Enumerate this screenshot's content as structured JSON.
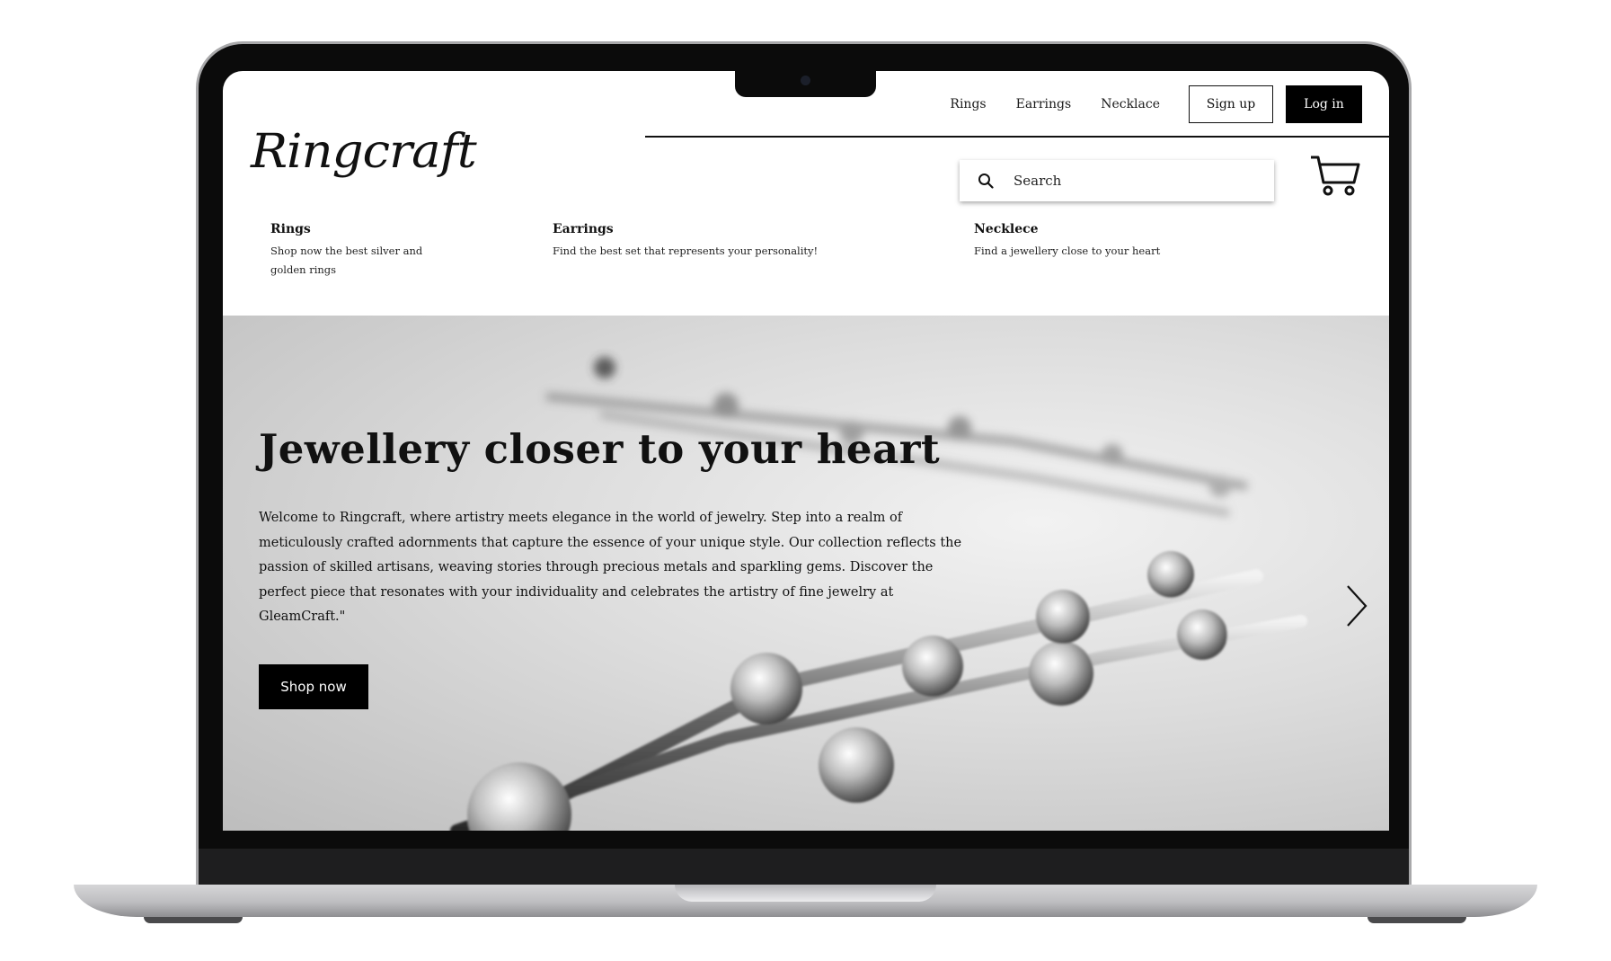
{
  "brand": {
    "logo_text": "Ringcraft"
  },
  "topnav": {
    "links": [
      "Rings",
      "Earrings",
      "Necklace"
    ],
    "signup_label": "Sign up",
    "login_label": "Log in"
  },
  "search": {
    "placeholder": "Search"
  },
  "categories": [
    {
      "title": "Rings",
      "description": "Shop now the best silver and golden rings"
    },
    {
      "title": "Earrings",
      "description": "Find the best set that represents your personality!"
    },
    {
      "title": "Necklece",
      "description": "Find a jewellery close to your heart"
    }
  ],
  "hero": {
    "title": "Jewellery closer to your heart",
    "body": "Welcome to Ringcraft, where artistry meets elegance in the world of jewelry. Step into a realm of meticulously crafted adornments that capture the essence of your unique style. Our collection reflects the passion of skilled artisans, weaving stories through precious metals and sparkling gems. Discover the perfect piece that resonates with your individuality and celebrates the artistry of fine jewelry at GleamCraft.\"",
    "cta_label": "Shop now"
  },
  "icons": {
    "search": "search-icon",
    "cart": "cart-icon",
    "next": "chevron-right-icon"
  },
  "colors": {
    "primary": "#000000",
    "background": "#ffffff",
    "frame": "#0b0b0b"
  }
}
